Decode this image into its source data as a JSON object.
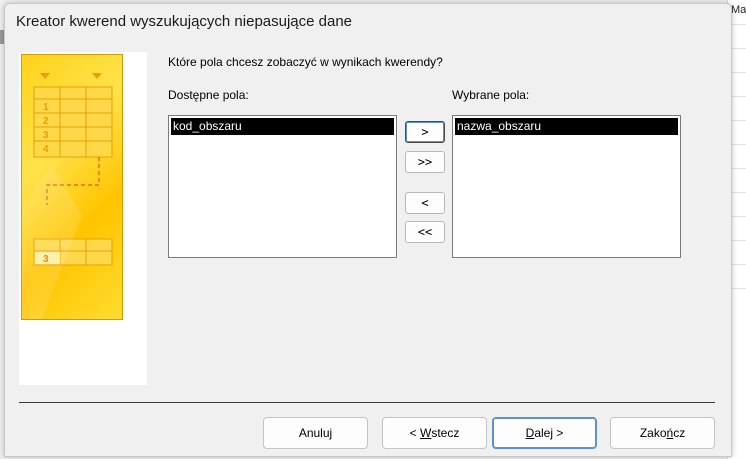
{
  "background": {
    "label": "Mak"
  },
  "dialog": {
    "title": "Kreator kwerend wyszukujących niepasujące dane",
    "prompt": "Które pola chcesz zobaczyć w wynikach kwerendy?",
    "available_label": "Dostępne pola:",
    "selected_label": "Wybrane pola:",
    "available_fields": [
      "kod_obszaru"
    ],
    "selected_fields": [
      "nazwa_obszaru"
    ],
    "move_buttons": {
      "add_one": ">",
      "add_all": ">>",
      "remove_one": "<",
      "remove_all": "<<"
    },
    "illustration": {
      "rows_top": [
        "1",
        "2",
        "3",
        "4"
      ],
      "row_bottom": "3"
    },
    "footer": {
      "cancel": "Anuluj",
      "back_prefix": "< ",
      "back_accel": "W",
      "back_rest": "stecz",
      "next_accel": "D",
      "next_rest": "alej >",
      "finish_prefix": "Zako",
      "finish_accel": "ń",
      "finish_rest": "cz"
    }
  },
  "colors": {
    "accent": "#5b8fd6",
    "illustration": "#ffcc00",
    "selection": "#000000"
  }
}
